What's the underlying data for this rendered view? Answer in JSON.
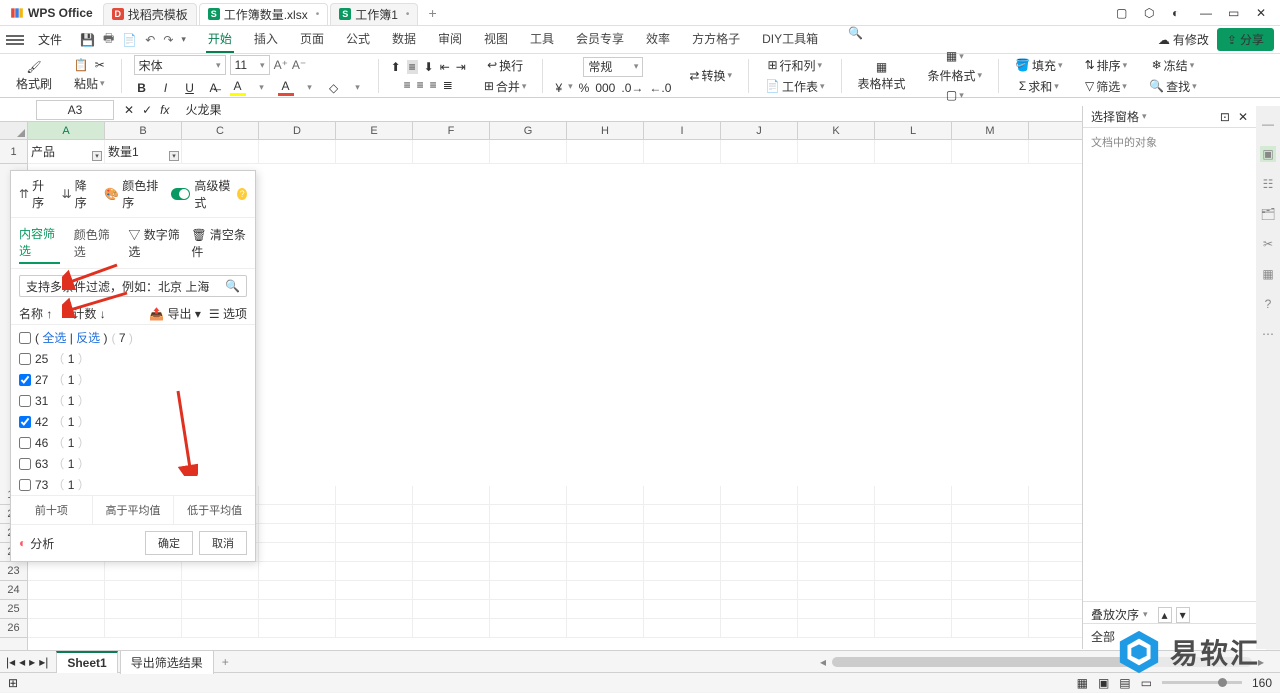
{
  "app": {
    "name": "WPS Office"
  },
  "tabs": [
    {
      "icon_bg": "#e24a3b",
      "icon": "D",
      "label": "找稻壳模板",
      "dirty": false
    },
    {
      "icon_bg": "#0a9960",
      "icon": "S",
      "label": "工作簿数量.xlsx",
      "dirty": true,
      "active": true
    },
    {
      "icon_bg": "#0a9960",
      "icon": "S",
      "label": "工作簿1",
      "dirty": true
    }
  ],
  "menubar": {
    "file": "文件",
    "tabs": [
      "开始",
      "插入",
      "页面",
      "公式",
      "数据",
      "审阅",
      "视图",
      "工具",
      "会员专享",
      "效率",
      "方方格子",
      "DIY工具箱"
    ],
    "active": 0,
    "changes": "有修改",
    "share": "分享"
  },
  "ribbon": {
    "format_painter": "格式刷",
    "paste": "粘贴",
    "font": "宋体",
    "size": "11",
    "wrap": "换行",
    "merge": "合并",
    "number_format": "常规",
    "convert": "转换",
    "row_col": "行和列",
    "worksheet": "工作表",
    "table_style": "表格样式",
    "conditional": "条件格式",
    "fill": "填充",
    "sort": "排序",
    "freeze": "冻结",
    "sum": "求和",
    "filter": "筛选",
    "find": "查找"
  },
  "namebox": "A3",
  "formula": "火龙果",
  "columns": [
    "A",
    "B",
    "C",
    "D",
    "E",
    "F",
    "G",
    "H",
    "I",
    "J",
    "K",
    "L",
    "M"
  ],
  "row_numbers": [
    "1",
    "19",
    "20",
    "21",
    "22",
    "23",
    "24",
    "25",
    "26"
  ],
  "row1": {
    "A": "产品",
    "B": "数量1"
  },
  "filter_popup": {
    "sort": {
      "asc": "升序",
      "desc": "降序",
      "color": "颜色排序",
      "adv": "高级模式"
    },
    "tabs": {
      "content": "内容筛选",
      "color": "颜色筛选",
      "number": "数字筛选",
      "clear": "清空条件"
    },
    "search_placeholder": "支持多条件过滤，例如：北京 上海",
    "cols": {
      "name": "名称",
      "count": "计数",
      "export": "导出",
      "options": "选项"
    },
    "all": {
      "select": "全选",
      "invert": "反选",
      "total": "7"
    },
    "items": [
      {
        "v": "25",
        "c": "1",
        "checked": false
      },
      {
        "v": "27",
        "c": "1",
        "checked": true
      },
      {
        "v": "31",
        "c": "1",
        "checked": false
      },
      {
        "v": "42",
        "c": "1",
        "checked": true
      },
      {
        "v": "46",
        "c": "1",
        "checked": false
      },
      {
        "v": "63",
        "c": "1",
        "checked": false
      },
      {
        "v": "73",
        "c": "1",
        "checked": false
      }
    ],
    "stats": {
      "top": "前十项",
      "above": "高于平均值",
      "below": "低于平均值"
    },
    "analyze": "分析",
    "ok": "确定",
    "cancel": "取消"
  },
  "sheet_tabs": {
    "s1": "Sheet1",
    "s2": "导出筛选结果"
  },
  "right_panel": {
    "title": "选择窗格",
    "sub": "文档中的对象",
    "stack": "叠放次序",
    "all": "全部"
  },
  "status": {
    "zoom": "160"
  },
  "watermark": "易软汇"
}
